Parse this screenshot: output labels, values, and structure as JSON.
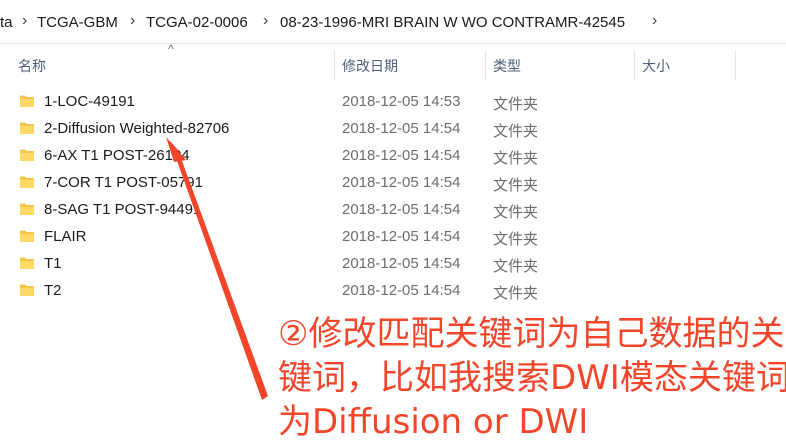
{
  "breadcrumb": {
    "items": [
      "ta",
      "TCGA-GBM",
      "TCGA-02-0006",
      "08-23-1996-MRI BRAIN W WO CONTRAMR-42545"
    ],
    "separator": "›"
  },
  "columns": {
    "name": "名称",
    "modified": "修改日期",
    "type": "类型",
    "size": "大小",
    "sort_indicator": "^"
  },
  "files": [
    {
      "name": "1-LOC-49191",
      "date": "2018-12-05 14:53",
      "type": "文件夹"
    },
    {
      "name": "2-Diffusion Weighted-82706",
      "date": "2018-12-05 14:54",
      "type": "文件夹"
    },
    {
      "name": "6-AX T1 POST-26104",
      "date": "2018-12-05 14:54",
      "type": "文件夹"
    },
    {
      "name": "7-COR T1 POST-05791",
      "date": "2018-12-05 14:54",
      "type": "文件夹"
    },
    {
      "name": "8-SAG T1 POST-94491",
      "date": "2018-12-05 14:54",
      "type": "文件夹"
    },
    {
      "name": "FLAIR",
      "date": "2018-12-05 14:54",
      "type": "文件夹"
    },
    {
      "name": "T1",
      "date": "2018-12-05 14:54",
      "type": "文件夹"
    },
    {
      "name": "T2",
      "date": "2018-12-05 14:54",
      "type": "文件夹"
    }
  ],
  "annotation": {
    "lines": [
      "②修改匹配关键词为自己数据的关",
      "键词，比如我搜索DWI模态关键词",
      "为Diffusion or DWI"
    ],
    "color": "#f2452a"
  },
  "icons": {
    "folder": "folder-icon",
    "breadcrumb_separator": "chevron-right-icon",
    "sort": "sort-ascending-icon"
  },
  "colors": {
    "folder": "#f3c64b",
    "header_text": "#4c607a",
    "meta_text": "#6d6d6d"
  }
}
